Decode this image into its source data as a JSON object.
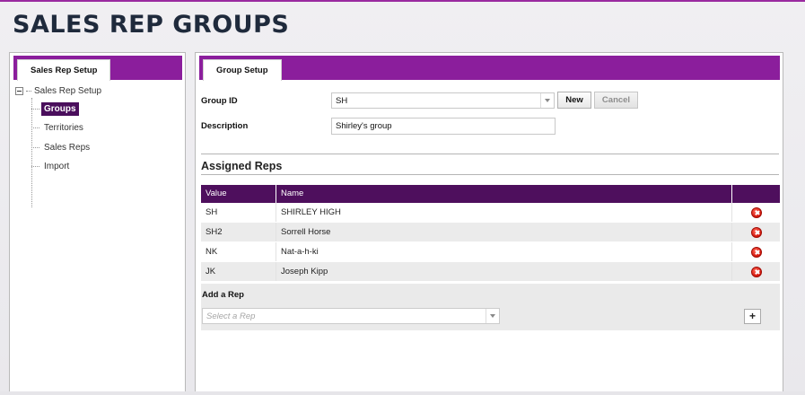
{
  "page": {
    "title": "SALES REP GROUPS"
  },
  "colors": {
    "accent": "#8b1e9c",
    "grid_header": "#4e0f5d",
    "selected": "#4a0e5c",
    "delete": "#d4160b"
  },
  "left_panel": {
    "tab_label": "Sales Rep Setup",
    "tree": {
      "root_label": "Sales Rep Setup",
      "items": [
        {
          "label": "Groups",
          "selected": true
        },
        {
          "label": "Territories",
          "selected": false
        },
        {
          "label": "Sales Reps",
          "selected": false
        },
        {
          "label": "Import",
          "selected": false
        }
      ]
    }
  },
  "right_panel": {
    "tab_label": "Group Setup",
    "group_id": {
      "label": "Group ID",
      "value": "SH"
    },
    "new_button": "New",
    "cancel_button": "Cancel",
    "description": {
      "label": "Description",
      "value": "Shirley's group"
    },
    "assigned_reps": {
      "title": "Assigned Reps",
      "columns": [
        "Value",
        "Name",
        ""
      ],
      "rows": [
        {
          "value": "SH",
          "name": "SHIRLEY HIGH"
        },
        {
          "value": "SH2",
          "name": "Sorrell Horse"
        },
        {
          "value": "NK",
          "name": "Nat-a-h-ki"
        },
        {
          "value": "JK",
          "name": "Joseph Kipp"
        }
      ],
      "row_action_icon": "delete-icon"
    },
    "add_rep": {
      "label": "Add a Rep",
      "placeholder": "Select a Rep",
      "add_button": "+"
    }
  }
}
